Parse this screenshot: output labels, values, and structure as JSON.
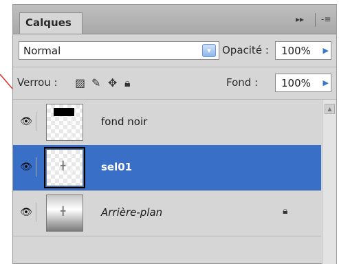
{
  "panel": {
    "tab_label": "Calques",
    "menu_expand": "▸▸",
    "menu_button": "-≡"
  },
  "blend": {
    "mode": "Normal",
    "opacity_label": "Opacité :",
    "opacity_value": "100%"
  },
  "lock": {
    "label": "Verrou :",
    "fill_label": "Fond :",
    "fill_value": "100%"
  },
  "layers": [
    {
      "name": "fond noir",
      "selected": false,
      "style": "normal",
      "locked": false
    },
    {
      "name": "sel01",
      "selected": true,
      "style": "bold",
      "locked": false
    },
    {
      "name": "Arrière-plan",
      "selected": false,
      "style": "italic",
      "locked": true
    }
  ],
  "colors": {
    "selection": "#3a6fc7",
    "annotation_arrow": "#e02020"
  }
}
